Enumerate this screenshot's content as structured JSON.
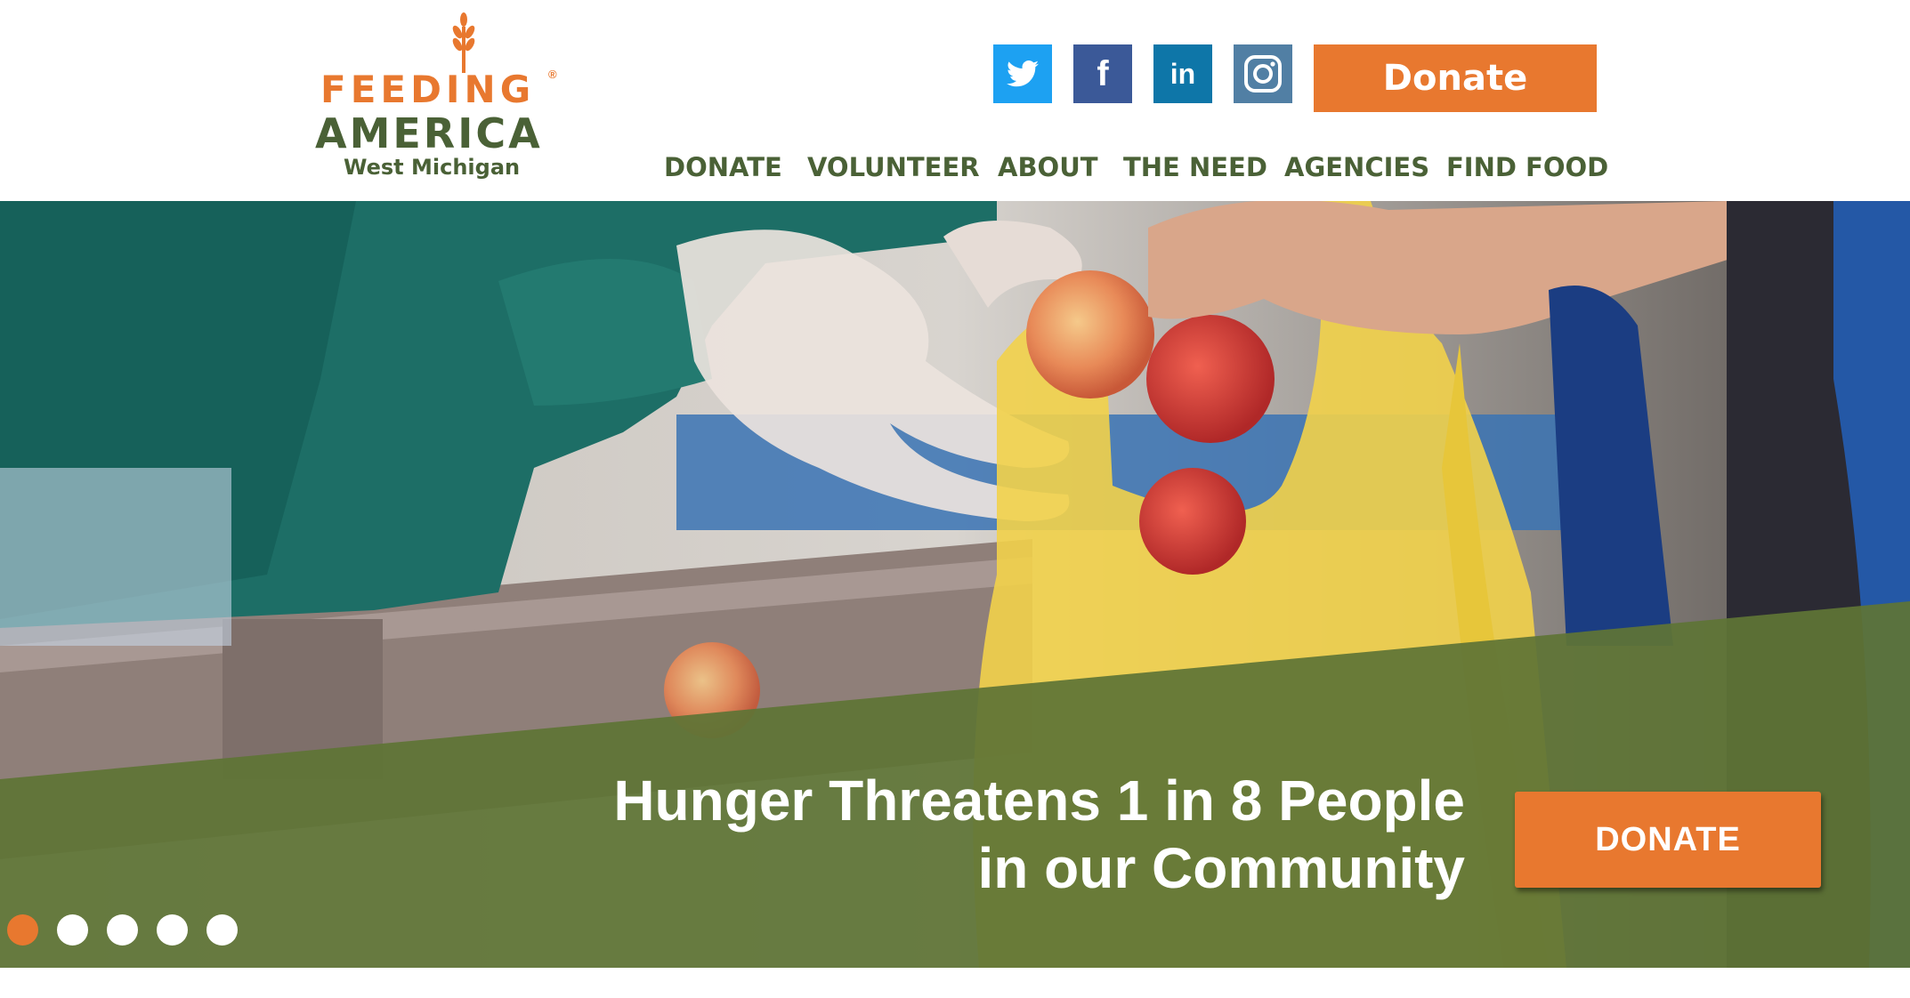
{
  "logo": {
    "line1": "FEEDING",
    "line2": "AMERICA",
    "line3": "West Michigan",
    "registered": "®"
  },
  "social": [
    {
      "name": "twitter-icon",
      "glyph": "🐦"
    },
    {
      "name": "facebook-icon",
      "glyph": "f"
    },
    {
      "name": "linkedin-icon",
      "glyph": "in"
    },
    {
      "name": "instagram-icon",
      "glyph": "◎"
    }
  ],
  "header": {
    "donate_label": "Donate"
  },
  "nav": {
    "items": [
      {
        "label": "DONATE"
      },
      {
        "label": "VOLUNTEER"
      },
      {
        "label": "ABOUT"
      },
      {
        "label": "THE NEED"
      },
      {
        "label": "AGENCIES"
      },
      {
        "label": "FIND FOOD"
      }
    ]
  },
  "hero": {
    "headline_line1": "Hunger Threatens 1 in 8 People",
    "headline_line2": "in our Community",
    "donate_label": "DONATE",
    "slides": 5,
    "active_slide": 1
  },
  "colors": {
    "brand_orange": "#e8782f",
    "brand_green": "#4a6136",
    "banner_green": "#5f7436"
  }
}
